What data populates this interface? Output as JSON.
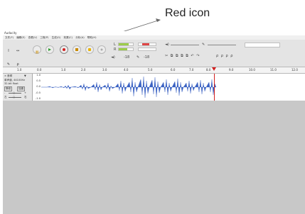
{
  "callout": {
    "text": "Red icon"
  },
  "window": {
    "title": "Audacity"
  },
  "menu": {
    "items": [
      "文件(F)",
      "编辑(E)",
      "查看(V)",
      "工程(P)",
      "生成(G)",
      "效果(C)",
      "分析(A)",
      "帮助(H)"
    ]
  },
  "toolbar": {
    "tools": [
      "I",
      "↔",
      "✎",
      "ρ",
      "↔",
      "✱"
    ],
    "transport": [
      "pause",
      "play",
      "stop",
      "skip-start",
      "record",
      "skip-end"
    ],
    "meter_labels": [
      "L",
      "R"
    ],
    "db_values": [
      "-18",
      "-18"
    ],
    "volume_labels": [
      "◄)",
      "✎"
    ]
  },
  "ruler": {
    "ticks": [
      "1.0",
      "0.0",
      "1.0",
      "2.0",
      "3.0",
      "4.0",
      "5.0",
      "6.0",
      "7.0",
      "8.0",
      "9.0",
      "10.0",
      "11.0",
      "12.0"
    ]
  },
  "track": {
    "name": "音频",
    "info": [
      "单声道, 44100Hz",
      "32-bit float"
    ],
    "buttons": [
      "静音",
      "独奏"
    ],
    "gain": [
      "-",
      "+"
    ],
    "pan": [
      "左",
      "右"
    ],
    "scale": [
      "1.0",
      "0.5",
      "0.0",
      "-0.5",
      "-1.0"
    ]
  },
  "colors": {
    "record": "#d31f1f",
    "waveform": "#3a62c3",
    "cursor": "#d31f1f",
    "meter_green": "#9ccc4a",
    "meter_red": "#e04545"
  }
}
